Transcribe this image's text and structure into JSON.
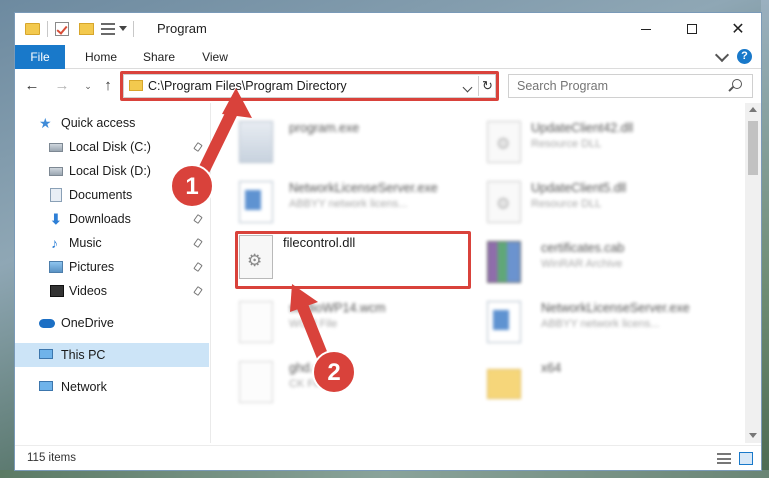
{
  "window": {
    "title": "Program",
    "controls": {
      "minimize": "",
      "maximize": "",
      "close": "✕"
    }
  },
  "ribbon": {
    "tabs": [
      {
        "label": "File",
        "active": true
      },
      {
        "label": "Home"
      },
      {
        "label": "Share"
      },
      {
        "label": "View"
      }
    ]
  },
  "navigation": {
    "address_path": "C:\\Program Files\\Program Directory",
    "search_placeholder": "Search Program",
    "back": "←",
    "forward": "→",
    "up": "↑",
    "refresh": "↻",
    "recent": "⌄"
  },
  "sidebar": {
    "items": [
      {
        "label": "Quick access",
        "icon": "star-icon",
        "pinned": false
      },
      {
        "label": "Local Disk (C:)",
        "icon": "drive-icon",
        "pinned": true
      },
      {
        "label": "Local Disk (D:)",
        "icon": "drive-icon",
        "pinned": false
      },
      {
        "label": "Documents",
        "icon": "documents-icon",
        "pinned": true
      },
      {
        "label": "Downloads",
        "icon": "download-icon",
        "pinned": true
      },
      {
        "label": "Music",
        "icon": "music-icon",
        "pinned": true
      },
      {
        "label": "Pictures",
        "icon": "pictures-icon",
        "pinned": true
      },
      {
        "label": "Videos",
        "icon": "videos-icon",
        "pinned": true
      },
      {
        "label": "OneDrive",
        "icon": "cloud-icon",
        "pinned": false
      },
      {
        "label": "This PC",
        "icon": "computer-icon",
        "pinned": false,
        "selected": true
      },
      {
        "label": "Network",
        "icon": "network-icon",
        "pinned": false
      }
    ]
  },
  "files": [
    {
      "name": "program.exe",
      "type": "",
      "icon": "exe-icon"
    },
    {
      "name": "UpdateClient42.dll",
      "type": "Resource DLL",
      "icon": "dll-icon"
    },
    {
      "name": "NetworkLicenseServer.exe",
      "type": "ABBYY network licens...",
      "icon": "exe-icon"
    },
    {
      "name": "UpdateClient5.dll",
      "type": "Resource DLL",
      "icon": "dll-icon"
    },
    {
      "name": "filecontrol.dll",
      "type": "",
      "icon": "dll-icon",
      "highlighted": true
    },
    {
      "name": "certificates.cab",
      "type": "WinRAR Archive",
      "icon": "archive-icon"
    },
    {
      "name": "studioWP14.wcm",
      "type": "WCM File",
      "icon": "document-icon"
    },
    {
      "name": "NetworkLicenseServer.exe",
      "type": "ABBYY network licens...",
      "icon": "exe-icon"
    },
    {
      "name": "ghd.dll",
      "type": "CK File",
      "icon": "document-icon"
    },
    {
      "name": "x64",
      "type": "",
      "icon": "folder-icon"
    }
  ],
  "status": {
    "item_count": "115 items"
  },
  "annotations": {
    "step1": "1",
    "step2": "2",
    "color": "#d9423b"
  },
  "colors": {
    "accent": "#1979ca",
    "selection": "#cce4f7",
    "highlight": "#d9423b"
  }
}
